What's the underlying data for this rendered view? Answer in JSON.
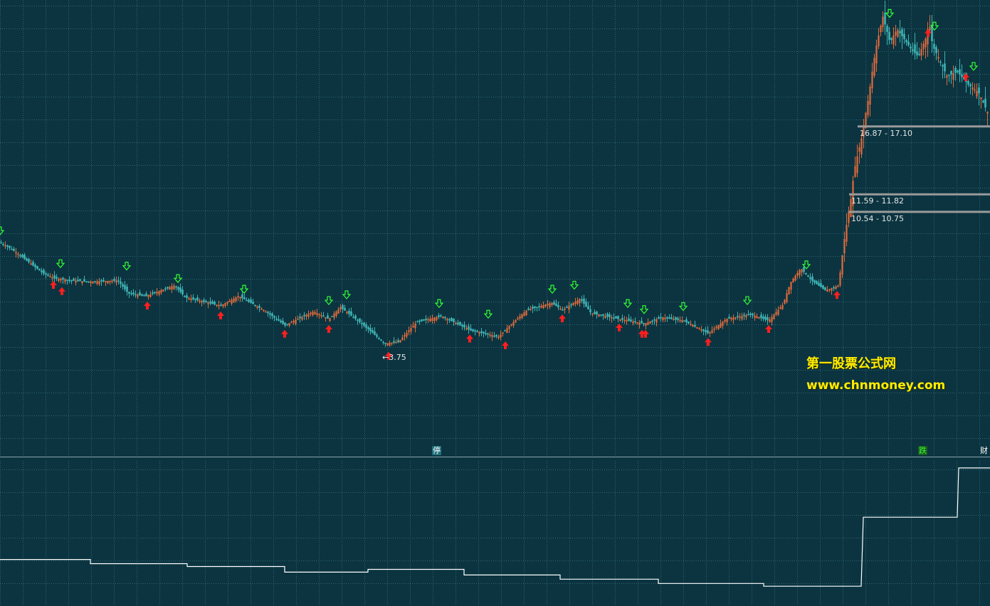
{
  "chart_data": [
    {
      "type": "candlestick",
      "panel": "main",
      "up_color": "#e06a3c",
      "down_color": "#3fb3b3",
      "buy_signal_color": "#ff1e1e",
      "sell_signal_color": "#33ff33",
      "close_path": [
        [
          0,
          9.1
        ],
        [
          15,
          8.8
        ],
        [
          35,
          8.3
        ],
        [
          60,
          7.7
        ],
        [
          75,
          7.5
        ],
        [
          100,
          7.4
        ],
        [
          130,
          7.35
        ],
        [
          165,
          7.4
        ],
        [
          180,
          6.9
        ],
        [
          205,
          6.8
        ],
        [
          245,
          7.2
        ],
        [
          260,
          6.75
        ],
        [
          310,
          6.45
        ],
        [
          335,
          6.8
        ],
        [
          370,
          6.3
        ],
        [
          400,
          5.8
        ],
        [
          440,
          6.25
        ],
        [
          462,
          6.0
        ],
        [
          478,
          6.4
        ],
        [
          505,
          5.9
        ],
        [
          540,
          5.25
        ],
        [
          560,
          5.3
        ],
        [
          585,
          5.9
        ],
        [
          620,
          6.1
        ],
        [
          660,
          5.65
        ],
        [
          700,
          5.45
        ],
        [
          740,
          6.3
        ],
        [
          775,
          6.55
        ],
        [
          790,
          6.3
        ],
        [
          815,
          6.7
        ],
        [
          830,
          6.2
        ],
        [
          870,
          6.0
        ],
        [
          905,
          5.85
        ],
        [
          930,
          6.05
        ],
        [
          960,
          5.95
        ],
        [
          995,
          5.55
        ],
        [
          1020,
          6.0
        ],
        [
          1055,
          6.15
        ],
        [
          1080,
          5.95
        ],
        [
          1100,
          6.5
        ],
        [
          1110,
          7.3
        ],
        [
          1125,
          7.9
        ],
        [
          1140,
          7.4
        ],
        [
          1160,
          7.0
        ],
        [
          1178,
          7.2
        ],
        [
          1185,
          9.0
        ],
        [
          1195,
          11.5
        ],
        [
          1200,
          13.5
        ],
        [
          1210,
          16.0
        ],
        [
          1220,
          20.0
        ],
        [
          1230,
          26.0
        ],
        [
          1240,
          31.0
        ],
        [
          1250,
          27.0
        ],
        [
          1260,
          29.0
        ],
        [
          1270,
          27.5
        ],
        [
          1280,
          26.0
        ],
        [
          1290,
          25.0
        ],
        [
          1300,
          27.5
        ],
        [
          1305,
          30.0
        ],
        [
          1310,
          26.5
        ],
        [
          1320,
          24.5
        ],
        [
          1330,
          22.5
        ],
        [
          1345,
          23.0
        ],
        [
          1360,
          21.5
        ],
        [
          1375,
          20.5
        ],
        [
          1391,
          17.8
        ]
      ],
      "y_range": [
        3.0,
        34.0
      ],
      "buy_signals": [
        [
          75,
          7.5
        ],
        [
          87,
          7.25
        ],
        [
          207,
          6.7
        ],
        [
          310,
          6.35
        ],
        [
          400,
          5.75
        ],
        [
          462,
          5.9
        ],
        [
          546,
          5.1
        ],
        [
          660,
          5.6
        ],
        [
          710,
          5.4
        ],
        [
          790,
          6.25
        ],
        [
          870,
          5.95
        ],
        [
          902,
          5.75
        ],
        [
          907,
          5.75
        ],
        [
          995,
          5.5
        ],
        [
          1080,
          5.9
        ],
        [
          1176,
          7.1
        ],
        [
          1304,
          29.5
        ],
        [
          1357,
          23.2
        ]
      ],
      "sell_signals": [
        [
          0,
          9.2
        ],
        [
          85,
          7.7
        ],
        [
          178,
          7.6
        ],
        [
          250,
          7.1
        ],
        [
          343,
          6.7
        ],
        [
          462,
          6.3
        ],
        [
          487,
          6.5
        ],
        [
          617,
          6.2
        ],
        [
          686,
          5.85
        ],
        [
          776,
          6.7
        ],
        [
          807,
          6.85
        ],
        [
          882,
          6.2
        ],
        [
          905,
          6.0
        ],
        [
          960,
          6.1
        ],
        [
          1050,
          6.3
        ],
        [
          1133,
          7.65
        ],
        [
          1250,
          30.0
        ],
        [
          1313,
          28.0
        ],
        [
          1368,
          22.5
        ]
      ],
      "min_label": "3.75",
      "price_zones": [
        "16.87 - 17.10",
        "11.59 - 11.82",
        "10.54 - 10.75"
      ],
      "zone_levels": [
        {
          "low": 16.87,
          "high": 17.1,
          "x_start": 1205
        },
        {
          "low": 11.59,
          "high": 11.82,
          "x_start": 1193
        },
        {
          "low": 10.54,
          "high": 10.75,
          "x_start": 1193
        }
      ],
      "markers": [
        {
          "text": "停",
          "x_data": 613,
          "bg": "#1f6f7a"
        },
        {
          "text": "跌",
          "x_data": 1296,
          "bg": "#1d5a20",
          "fg": "#33ff33"
        },
        {
          "text": "财",
          "x_data": 1382,
          "bg": "#0b3440"
        }
      ]
    },
    {
      "type": "line",
      "panel": "indicator",
      "color": "#ffffff",
      "step_points": [
        [
          0,
          0.3
        ],
        [
          127,
          0.3
        ],
        [
          127,
          0.27
        ],
        [
          263,
          0.27
        ],
        [
          263,
          0.25
        ],
        [
          400,
          0.25
        ],
        [
          400,
          0.21
        ],
        [
          517,
          0.21
        ],
        [
          517,
          0.23
        ],
        [
          652,
          0.23
        ],
        [
          652,
          0.19
        ],
        [
          787,
          0.19
        ],
        [
          787,
          0.16
        ],
        [
          925,
          0.16
        ],
        [
          925,
          0.13
        ],
        [
          1073,
          0.13
        ],
        [
          1073,
          0.11
        ],
        [
          1210,
          0.11
        ],
        [
          1213,
          0.6
        ],
        [
          1345,
          0.6
        ],
        [
          1347,
          0.95
        ],
        [
          1391,
          0.95
        ]
      ],
      "y_range": [
        0,
        1
      ]
    }
  ],
  "watermark": {
    "title": "第一股票公式网",
    "url": "www.chnmoney.com"
  },
  "colors": {
    "background": "#0b3440",
    "grid": "#2f6571",
    "separator": "#8aa5ad",
    "zone_line": "#9a9a9a"
  }
}
